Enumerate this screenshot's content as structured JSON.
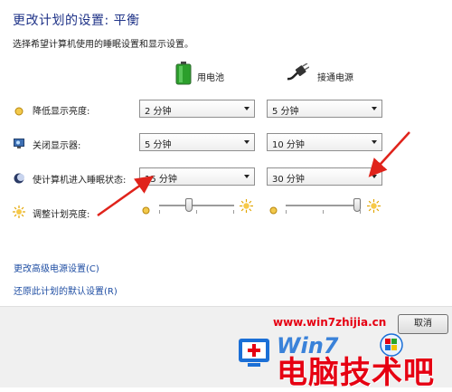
{
  "header": {
    "title": "更改计划的设置: 平衡",
    "subtitle": "选择希望计算机使用的睡眠设置和显示设置。"
  },
  "columns": {
    "battery": "用电池",
    "plugged_in": "接通电源"
  },
  "rows": {
    "dim_display": {
      "label": "降低显示亮度:",
      "battery": "2 分钟",
      "plugged": "5 分钟"
    },
    "turn_off_display": {
      "label": "关闭显示器:",
      "battery": "5 分钟",
      "plugged": "10 分钟"
    },
    "sleep": {
      "label": "使计算机进入睡眠状态:",
      "battery": "15 分钟",
      "plugged": "30 分钟"
    },
    "brightness": {
      "label": "调整计划亮度:",
      "battery_level": 0.4,
      "plugged_level": 0.95
    }
  },
  "links": {
    "advanced": "更改高级电源设置(C)",
    "restore": "还原此计划的默认设置(R)"
  },
  "footer": {
    "cancel": "取消"
  },
  "watermark": {
    "url": "www.win7zhijia.cn",
    "brand_big": "电脑技术吧",
    "logo_text": "Win7"
  },
  "colors": {
    "accent_title": "#1e3287",
    "link": "#1f4ea3",
    "annotation_red": "#e0231b",
    "watermark_red": "#e60012",
    "watermark_blue": "#1b6fd6"
  }
}
